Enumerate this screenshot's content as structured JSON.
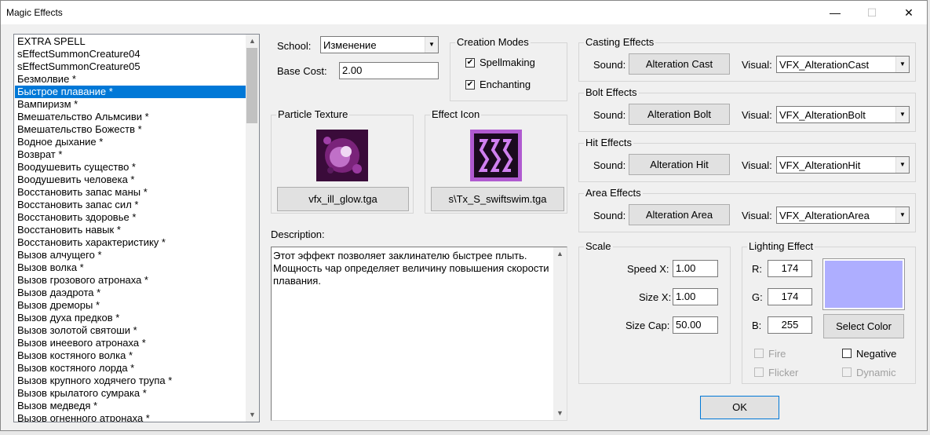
{
  "window": {
    "title": "Magic Effects",
    "minimize": "—",
    "maximize": "☐",
    "close": "✕"
  },
  "effects_list": {
    "items": [
      "EXTRA SPELL",
      "sEffectSummonCreature04",
      "sEffectSummonCreature05",
      "Безмолвие *",
      "Быстрое плавание *",
      "Вампиризм *",
      "Вмешательство Альмсиви *",
      "Вмешательство Божеств *",
      "Водное дыхание *",
      "Возврат *",
      "Воодушевить существо *",
      "Воодушевить человека *",
      "Восстановить запас маны *",
      "Восстановить запас сил *",
      "Восстановить здоровье *",
      "Восстановить навык *",
      "Восстановить характеристику *",
      "Вызов алчущего *",
      "Вызов волка *",
      "Вызов грозового атронаха *",
      "Вызов даэдрота *",
      "Вызов дреморы *",
      "Вызов духа предков *",
      "Вызов золотой святоши *",
      "Вызов инеевого атронаха *",
      "Вызов костяного волка *",
      "Вызов костяного лорда *",
      "Вызов крупного ходячего трупа *",
      "Вызов крылатого сумрака *",
      "Вызов медведя *",
      "Вызов огненного атронаха *"
    ],
    "selected_index": 4
  },
  "school": {
    "label": "School:",
    "value": "Изменение"
  },
  "base_cost": {
    "label": "Base Cost:",
    "value": "2.00"
  },
  "creation_modes": {
    "title": "Creation Modes",
    "spellmaking": "Spellmaking",
    "enchanting": "Enchanting",
    "spellmaking_checked": true,
    "enchanting_checked": true
  },
  "particle_texture": {
    "title": "Particle Texture",
    "button": "vfx_ill_glow.tga"
  },
  "effect_icon": {
    "title": "Effect Icon",
    "button": "s\\Tx_S_swiftswim.tga"
  },
  "description": {
    "label": "Description:",
    "text": "Этот эффект позволяет заклинателю быстрее плыть. Мощность чар определяет величину повышения скорости плавания."
  },
  "casting": {
    "title": "Casting Effects",
    "sound_label": "Sound:",
    "sound": "Alteration Cast",
    "visual_label": "Visual:",
    "visual": "VFX_AlterationCast"
  },
  "bolt": {
    "title": "Bolt Effects",
    "sound_label": "Sound:",
    "sound": "Alteration Bolt",
    "visual_label": "Visual:",
    "visual": "VFX_AlterationBolt"
  },
  "hit": {
    "title": "Hit Effects",
    "sound_label": "Sound:",
    "sound": "Alteration Hit",
    "visual_label": "Visual:",
    "visual": "VFX_AlterationHit"
  },
  "area": {
    "title": "Area Effects",
    "sound_label": "Sound:",
    "sound": "Alteration Area",
    "visual_label": "Visual:",
    "visual": "VFX_AlterationArea"
  },
  "scale": {
    "title": "Scale",
    "speed_x_label": "Speed X:",
    "speed_x": "1.00",
    "size_x_label": "Size X:",
    "size_x": "1.00",
    "size_cap_label": "Size Cap:",
    "size_cap": "50.00"
  },
  "lighting": {
    "title": "Lighting Effect",
    "r_label": "R:",
    "r": "174",
    "g_label": "G:",
    "g": "174",
    "b_label": "B:",
    "b": "255",
    "swatch_color": "#aeaeff",
    "select_color": "Select Color",
    "fire": "Fire",
    "negative": "Negative",
    "flicker": "Flicker",
    "dynamic": "Dynamic"
  },
  "ok": "OK"
}
